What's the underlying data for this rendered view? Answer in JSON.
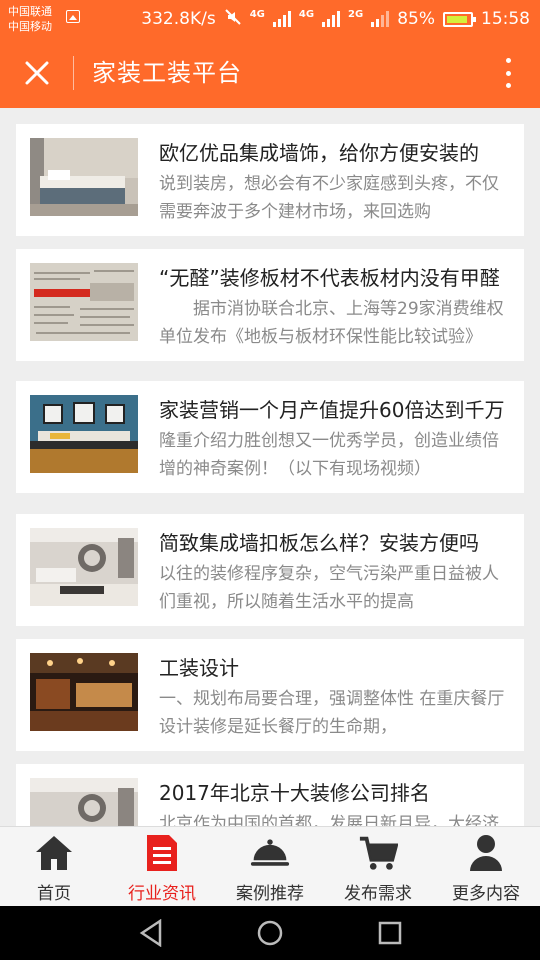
{
  "status": {
    "carrier_1": "中国联通",
    "carrier_2": "中国移动",
    "speed": "332.8K/s",
    "net_1": "4G",
    "net_2": "4G",
    "net_3": "2G",
    "battery": "85%",
    "time": "15:58"
  },
  "header": {
    "title": "家装工装平台"
  },
  "articles": [
    {
      "title": "欧亿优品集成墙饰，给你方便安装的",
      "desc": "说到装房，想必会有不少家庭感到头疼，不仅需要奔波于多个建材市场，来回选购"
    },
    {
      "title": "“无醛”装修板材不代表板材内没有甲醛",
      "desc": "　　据市消协联合北京、上海等29家消费维权单位发布《地板与板材环保性能比较试验》"
    },
    {
      "title": "家装营销一个月产值提升60倍达到千万",
      "desc": "隆重介绍力胜创想又一优秀学员，创造业绩倍增的神奇案例！（以下有现场视频）"
    },
    {
      "title": "简致集成墙扣板怎么样？安装方便吗",
      "desc": "以往的装修程序复杂，空气污染严重日益被人们重视，所以随着生活水平的提高"
    },
    {
      "title": "工装设计",
      "desc": "一、规划布局要合理，强调整体性 在重庆餐厅设计装修是延长餐厅的生命期，"
    },
    {
      "title": "2017年北京十大装修公司排名",
      "desc": "北京作为中国的首都，发展日新月异，大经济"
    }
  ],
  "nav": {
    "items": [
      {
        "label": "首页",
        "icon": "home-icon"
      },
      {
        "label": "行业资讯",
        "icon": "document-icon"
      },
      {
        "label": "案例推荐",
        "icon": "cloche-icon"
      },
      {
        "label": "发布需求",
        "icon": "cart-icon"
      },
      {
        "label": "更多内容",
        "icon": "user-icon"
      }
    ],
    "active_index": 1
  },
  "colors": {
    "brand": "#ff6a2a",
    "active": "#e8211d"
  }
}
